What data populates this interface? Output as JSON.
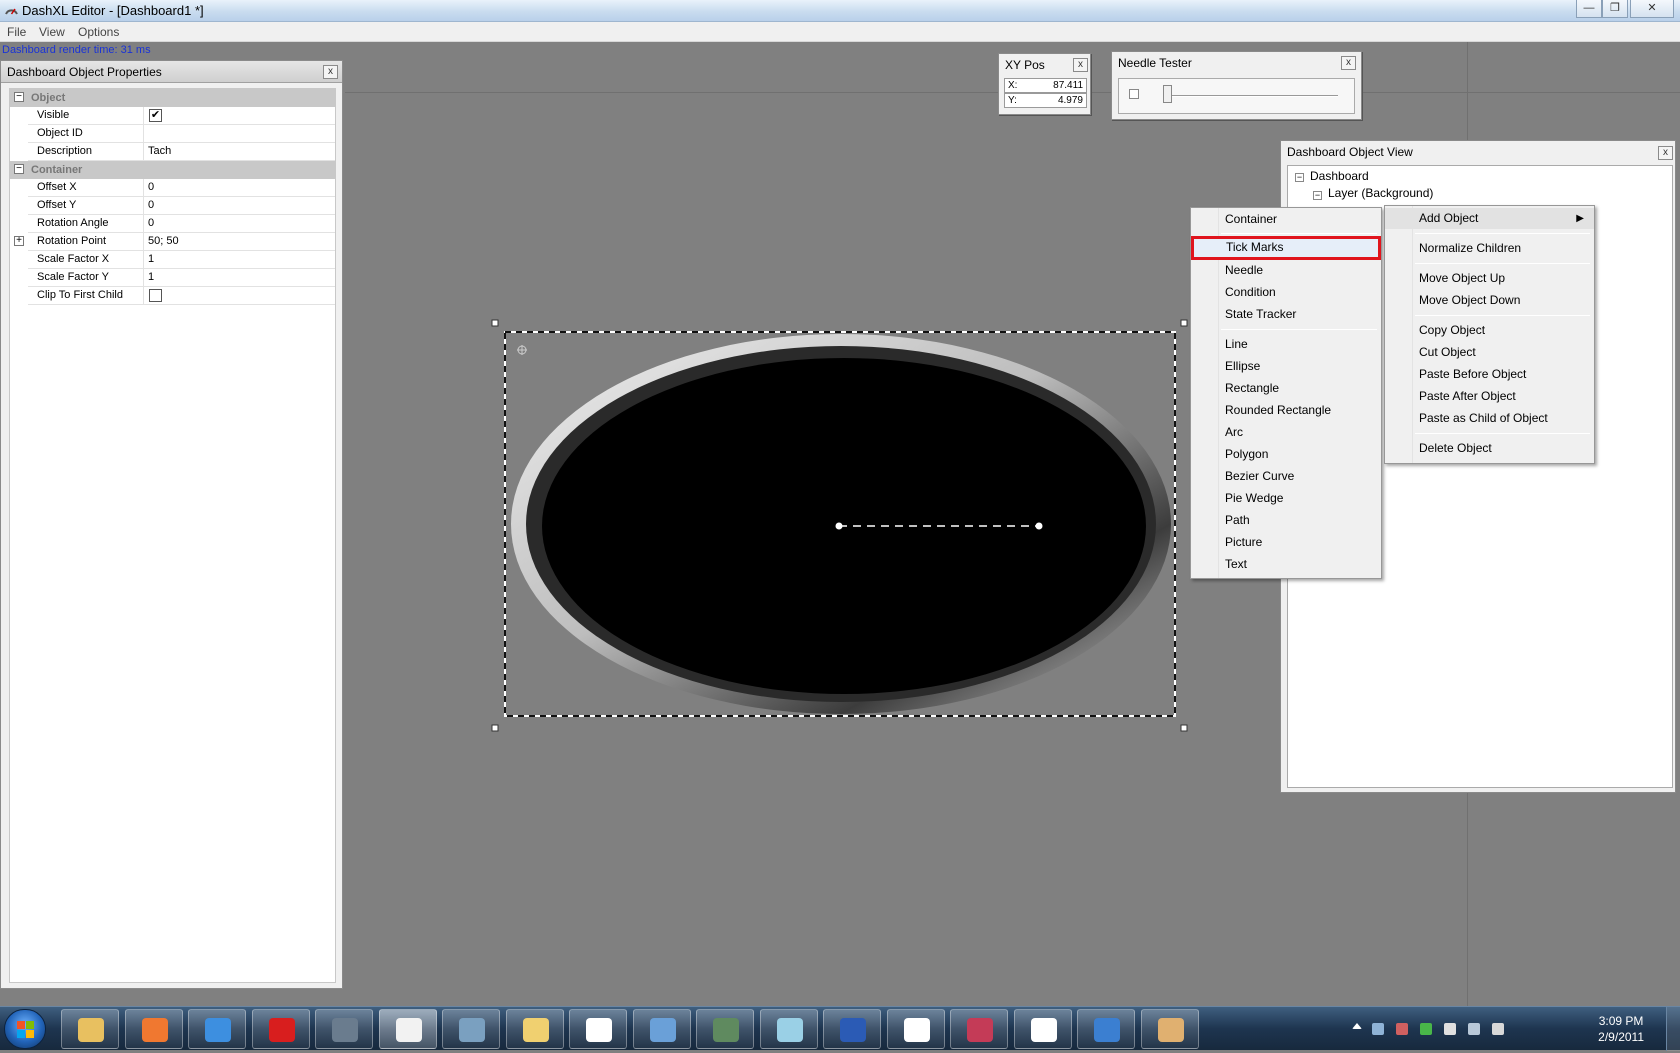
{
  "window": {
    "title": "DashXL Editor - [Dashboard1 *]",
    "btn_min": "—",
    "btn_max": "❐",
    "btn_close": "✕"
  },
  "menubar": {
    "file": "File",
    "view": "View",
    "options": "Options"
  },
  "status": {
    "render_time": "Dashboard render time: 31 ms"
  },
  "properties": {
    "title": "Dashboard Object Properties",
    "close": "x",
    "cat_object": "Object",
    "cat_container": "Container",
    "rows": [
      {
        "name": "Visible",
        "value": "✔",
        "type": "checkbox"
      },
      {
        "name": "Object ID",
        "value": ""
      },
      {
        "name": "Description",
        "value": "Tach"
      },
      {
        "name": "Offset X",
        "value": "0"
      },
      {
        "name": "Offset Y",
        "value": "0"
      },
      {
        "name": "Rotation Angle",
        "value": "0"
      },
      {
        "name": "Rotation Point",
        "value": "50; 50"
      },
      {
        "name": "Scale Factor X",
        "value": "1"
      },
      {
        "name": "Scale Factor Y",
        "value": "1"
      },
      {
        "name": "Clip To First Child",
        "value": "",
        "type": "checkbox"
      }
    ]
  },
  "xypos": {
    "title": "XY Pos",
    "close": "x",
    "x_label": "X:",
    "x_value": "87.411",
    "y_label": "Y:",
    "y_value": "4.979"
  },
  "needle_tester": {
    "title": "Needle Tester",
    "close": "x",
    "level": 0.02
  },
  "object_view": {
    "title": "Dashboard Object View",
    "close": "x",
    "root": "Dashboard",
    "layer": "Layer (Background)"
  },
  "add_submenu": {
    "items": [
      "Container",
      "Tick Marks",
      "Needle",
      "Condition",
      "State Tracker",
      "Line",
      "Ellipse",
      "Rectangle",
      "Rounded Rectangle",
      "Arc",
      "Polygon",
      "Bezier Curve",
      "Pie Wedge",
      "Path",
      "Picture",
      "Text"
    ],
    "highlighted": "Tick Marks"
  },
  "context_menu": {
    "add_object": "Add Object",
    "normalize_children": "Normalize Children",
    "move_up": "Move Object Up",
    "move_down": "Move Object Down",
    "copy": "Copy Object",
    "cut": "Cut Object",
    "paste_before": "Paste Before Object",
    "paste_after": "Paste After Object",
    "paste_child": "Paste as Child of Object",
    "delete": "Delete Object"
  },
  "clock": {
    "time": "3:09 PM",
    "date": "2/9/2011"
  },
  "taskbar_icons": [
    "explorer-icon",
    "virtualbox-icon",
    "internet-explorer-icon",
    "opera-icon",
    "steam-icon",
    "dashxl-editor-icon",
    "network-tool-icon",
    "paint-icon",
    "document-icon",
    "remote-desktop-icon",
    "terminal-icon",
    "sticky-notes-icon",
    "word-icon",
    "document-icon",
    "powerpoint-icon",
    "document-icon",
    "itunes-icon",
    "paint-palette-icon"
  ],
  "colors": {
    "canvas": "#808080",
    "highlight_outline": "#e0141d",
    "render_time_text": "#1a33d6"
  }
}
